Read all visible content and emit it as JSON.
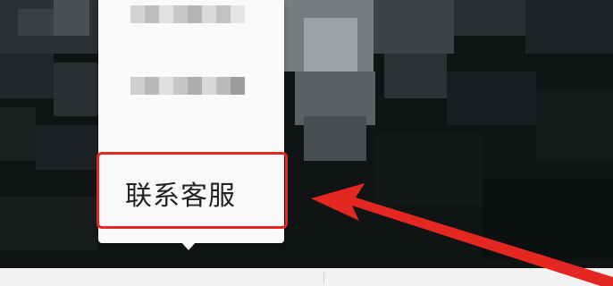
{
  "menu": {
    "items": [
      {
        "label": ""
      },
      {
        "label": ""
      },
      {
        "label": "联系客服"
      }
    ]
  },
  "colors": {
    "highlight": "#e52722",
    "menu_bg": "#fafafa",
    "background": "#0f1314"
  },
  "icons": [
    "arrow-annotation-icon"
  ]
}
